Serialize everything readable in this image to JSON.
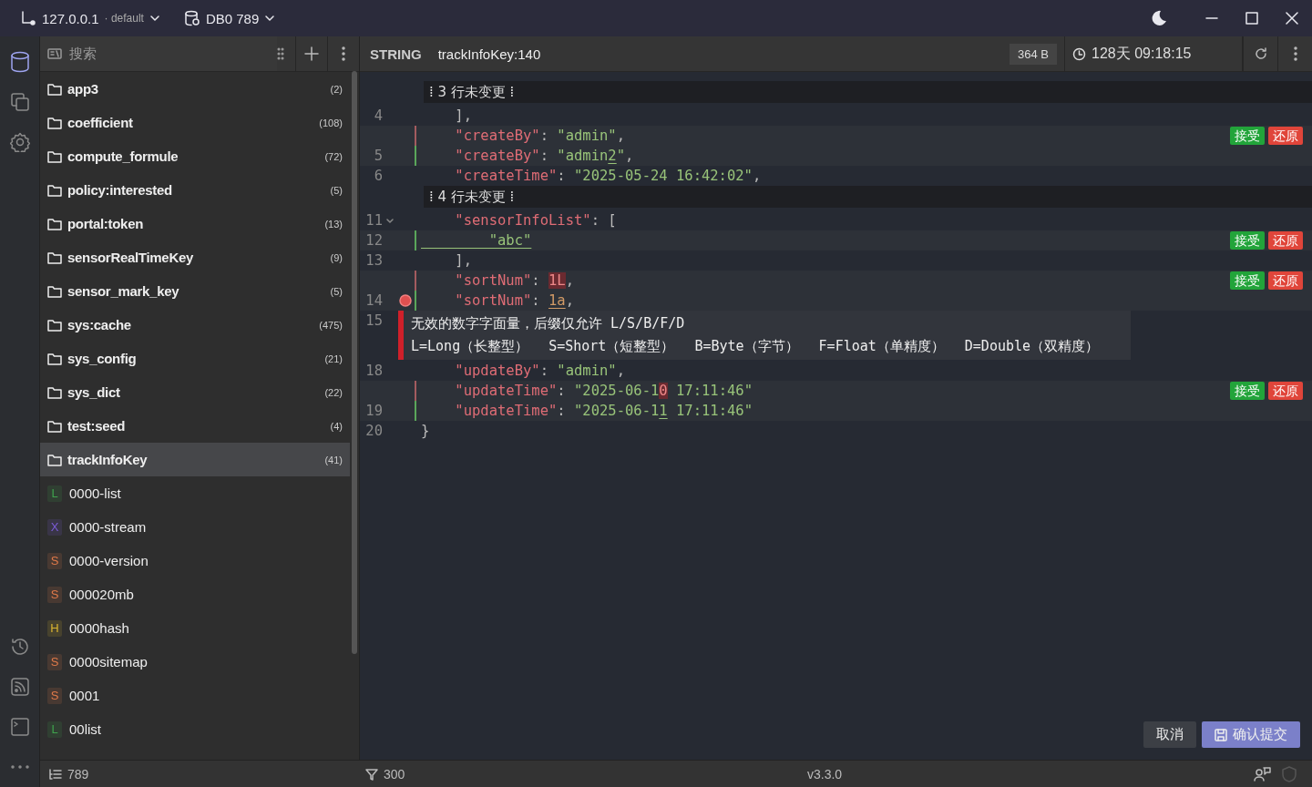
{
  "titlebar": {
    "host": "127.0.0.1",
    "profile": "· default",
    "database": "DB0 789"
  },
  "sidebar": {
    "search": {
      "placeholder": "搜索"
    },
    "items": [
      {
        "kind": "folder",
        "name": "app3",
        "count": "(2)",
        "selected": false
      },
      {
        "kind": "folder",
        "name": "coefficient",
        "count": "(108)",
        "selected": false
      },
      {
        "kind": "folder",
        "name": "compute_formule",
        "count": "(72)",
        "selected": false
      },
      {
        "kind": "folder",
        "name": "policy:interested",
        "count": "(5)",
        "selected": false
      },
      {
        "kind": "folder",
        "name": "portal:token",
        "count": "(13)",
        "selected": false
      },
      {
        "kind": "folder",
        "name": "sensorRealTimeKey",
        "count": "(9)",
        "selected": false
      },
      {
        "kind": "folder",
        "name": "sensor_mark_key",
        "count": "(5)",
        "selected": false
      },
      {
        "kind": "folder",
        "name": "sys:cache",
        "count": "(475)",
        "selected": false
      },
      {
        "kind": "folder",
        "name": "sys_config",
        "count": "(21)",
        "selected": false
      },
      {
        "kind": "folder",
        "name": "sys_dict",
        "count": "(22)",
        "selected": false
      },
      {
        "kind": "folder",
        "name": "test:seed",
        "count": "(4)",
        "selected": false
      },
      {
        "kind": "folder",
        "name": "trackInfoKey",
        "count": "(41)",
        "selected": true
      },
      {
        "kind": "key",
        "type": "L",
        "color": "#3fa34d",
        "name": "0000-list",
        "selected": false
      },
      {
        "kind": "key",
        "type": "X",
        "color": "#7b5bd6",
        "name": "0000-stream",
        "selected": false
      },
      {
        "kind": "key",
        "type": "S",
        "color": "#e07a4a",
        "name": "0000-version",
        "selected": false
      },
      {
        "kind": "key",
        "type": "S",
        "color": "#e07a4a",
        "name": "000020mb",
        "selected": false
      },
      {
        "kind": "key",
        "type": "H",
        "color": "#d9b430",
        "name": "0000hash",
        "selected": false
      },
      {
        "kind": "key",
        "type": "S",
        "color": "#e07a4a",
        "name": "0000sitemap",
        "selected": false
      },
      {
        "kind": "key",
        "type": "S",
        "color": "#e07a4a",
        "name": "0001",
        "selected": false
      },
      {
        "kind": "key",
        "type": "L",
        "color": "#3fa34d",
        "name": "00list",
        "selected": false
      }
    ]
  },
  "editor": {
    "type": "STRING",
    "key": "trackInfoKey:140",
    "size": "364 B",
    "ttl": "128天 09:18:15",
    "rows": [
      {
        "kind": "fold",
        "text": "⁞ 3 行未变更 ⁞"
      },
      {
        "kind": "context",
        "number": "4",
        "code": [
          {
            "text": "    ],",
            "kind": "punct"
          }
        ]
      },
      {
        "kind": "removed",
        "code": [
          {
            "text": "    \"createBy\"",
            "kind": "key"
          },
          {
            "text": ": ",
            "kind": "punct"
          },
          {
            "text": "\"admin\"",
            "kind": "string"
          },
          {
            "text": ",",
            "kind": "punct"
          }
        ],
        "actions": {
          "accept": "接受",
          "revert": "还原"
        }
      },
      {
        "kind": "added",
        "number": "5",
        "code": [
          {
            "text": "    \"createBy\"",
            "kind": "key"
          },
          {
            "text": ": ",
            "kind": "punct"
          },
          {
            "text": "\"admin",
            "kind": "string"
          },
          {
            "text": "2",
            "kind": "string",
            "changed": true
          },
          {
            "text": "\"",
            "kind": "string"
          },
          {
            "text": ",",
            "kind": "punct"
          }
        ]
      },
      {
        "kind": "context",
        "number": "6",
        "code": [
          {
            "text": "    \"createTime\"",
            "kind": "key"
          },
          {
            "text": ": ",
            "kind": "punct"
          },
          {
            "text": "\"2025-05-24 16:42:02\"",
            "kind": "string"
          },
          {
            "text": ",",
            "kind": "punct"
          }
        ]
      },
      {
        "kind": "fold",
        "text": "⁞ 4 行未变更 ⁞"
      },
      {
        "kind": "context",
        "number": "11",
        "expanded": true,
        "code": [
          {
            "text": "    \"sensorInfoList\"",
            "kind": "key"
          },
          {
            "text": ": [",
            "kind": "punct"
          }
        ]
      },
      {
        "kind": "added",
        "number": "12",
        "code": [
          {
            "text": "        \"abc\"",
            "kind": "string",
            "changed": true
          }
        ],
        "actions": {
          "accept": "接受",
          "revert": "还原"
        }
      },
      {
        "kind": "context",
        "number": "13",
        "code": [
          {
            "text": "    ],",
            "kind": "punct"
          }
        ]
      },
      {
        "kind": "removed",
        "code": [
          {
            "text": "    \"sortNum\"",
            "kind": "key"
          },
          {
            "text": ": ",
            "kind": "punct"
          },
          {
            "text": "1L",
            "kind": "number",
            "changed": true
          },
          {
            "text": ",",
            "kind": "punct"
          }
        ],
        "actions": {
          "accept": "接受",
          "revert": "还原"
        }
      },
      {
        "kind": "added",
        "number": "14",
        "error": true,
        "code": [
          {
            "text": "    \"sortNum\"",
            "kind": "key"
          },
          {
            "text": ": ",
            "kind": "punct"
          },
          {
            "text": "1a",
            "kind": "number",
            "changed": true
          },
          {
            "text": ",",
            "kind": "punct"
          }
        ]
      },
      {
        "kind": "context",
        "number": "15",
        "tooltip": {
          "title": "无效的数字字面量，后缀仅允许 L/S/B/F/D",
          "hints": [
            "L=Long（长整型）",
            "S=Short（短整型）",
            "B=Byte（字节）",
            "F=Float（单精度）",
            "D=Double（双精度）"
          ]
        }
      },
      {
        "kind": "context",
        "number": "18",
        "code": [
          {
            "text": "    \"updateBy\"",
            "kind": "key"
          },
          {
            "text": ": ",
            "kind": "punct"
          },
          {
            "text": "\"admin\"",
            "kind": "string"
          },
          {
            "text": ",",
            "kind": "punct"
          }
        ]
      },
      {
        "kind": "removed",
        "code": [
          {
            "text": "    \"updateTime\"",
            "kind": "key"
          },
          {
            "text": ": ",
            "kind": "punct"
          },
          {
            "text": "\"2025-06-1",
            "kind": "string"
          },
          {
            "text": "0",
            "kind": "string",
            "changed": true
          },
          {
            "text": " 17:11:46\"",
            "kind": "string"
          }
        ],
        "actions": {
          "accept": "接受",
          "revert": "还原"
        }
      },
      {
        "kind": "added",
        "number": "19",
        "code": [
          {
            "text": "    \"updateTime\"",
            "kind": "key"
          },
          {
            "text": ": ",
            "kind": "punct"
          },
          {
            "text": "\"2025-06-1",
            "kind": "string"
          },
          {
            "text": "1",
            "kind": "string",
            "changed": true
          },
          {
            "text": " 17:11:46\"",
            "kind": "string"
          }
        ]
      },
      {
        "kind": "context",
        "number": "20",
        "code": [
          {
            "text": "}",
            "kind": "punct"
          }
        ]
      }
    ],
    "buttons": {
      "cancel": "取消",
      "confirm": "确认提交"
    }
  },
  "status_bar": {
    "keys": "789",
    "filtered": "300",
    "version": "v3.3.0"
  }
}
